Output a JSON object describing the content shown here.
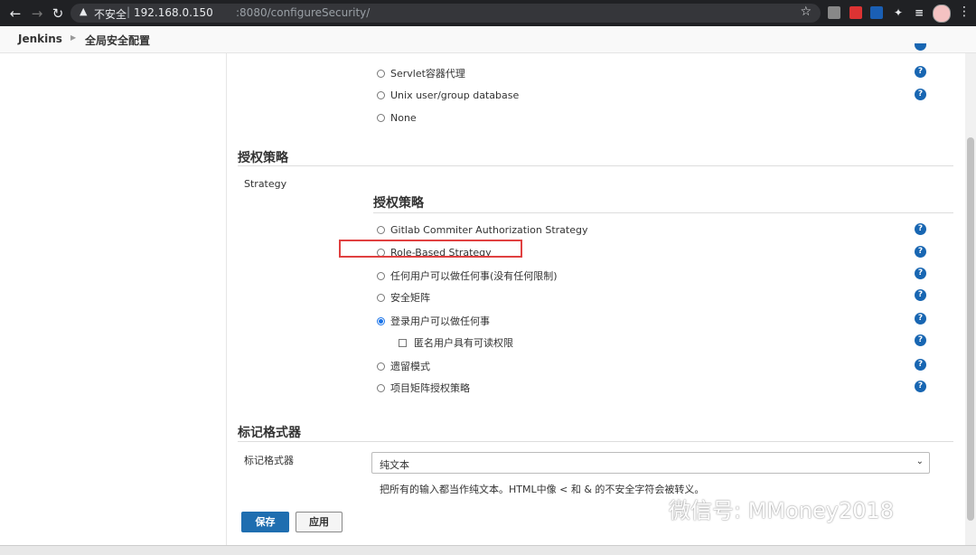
{
  "browser": {
    "back_icon": "arrow-left-icon",
    "forward_icon": "arrow-right-icon",
    "reload_icon": "reload-icon",
    "insecure_label": "不安全",
    "url_host": "192.168.0.150",
    "url_rest": ":8080/configureSecurity/",
    "bookmark_icon": "star-icon"
  },
  "breadcrumbs": {
    "root": "Jenkins",
    "current": "全局安全配置"
  },
  "security_realm": {
    "options": [
      {
        "label": "Servlet容器代理",
        "selected": false
      },
      {
        "label": "Unix user/group database",
        "selected": false
      },
      {
        "label": "None",
        "selected": false
      }
    ]
  },
  "authorization": {
    "section_title": "授权策略",
    "field_label": "Strategy",
    "sub_title": "授权策略",
    "options": [
      {
        "label": "Gitlab Commiter Authorization Strategy",
        "selected": false
      },
      {
        "label": "Role-Based Strategy",
        "selected": false
      },
      {
        "label": "任何用户可以做任何事(没有任何限制)",
        "selected": false
      },
      {
        "label": "安全矩阵",
        "selected": false
      },
      {
        "label": "登录用户可以做任何事",
        "selected": true
      },
      {
        "label": "匿名用户具有可读权限",
        "checked": false
      },
      {
        "label": "遗留模式",
        "selected": false
      },
      {
        "label": "项目矩阵授权策略",
        "selected": false
      }
    ]
  },
  "markup": {
    "section_title": "标记格式器",
    "field_label": "标记格式器",
    "selected_value": "纯文本",
    "description": "把所有的输入都当作纯文本。HTML中像 < 和 & 的不安全字符会被转义。"
  },
  "buttons": {
    "save": "保存",
    "apply": "应用"
  },
  "help_glyph": "?",
  "watermark": "微信号: MMoney2018"
}
